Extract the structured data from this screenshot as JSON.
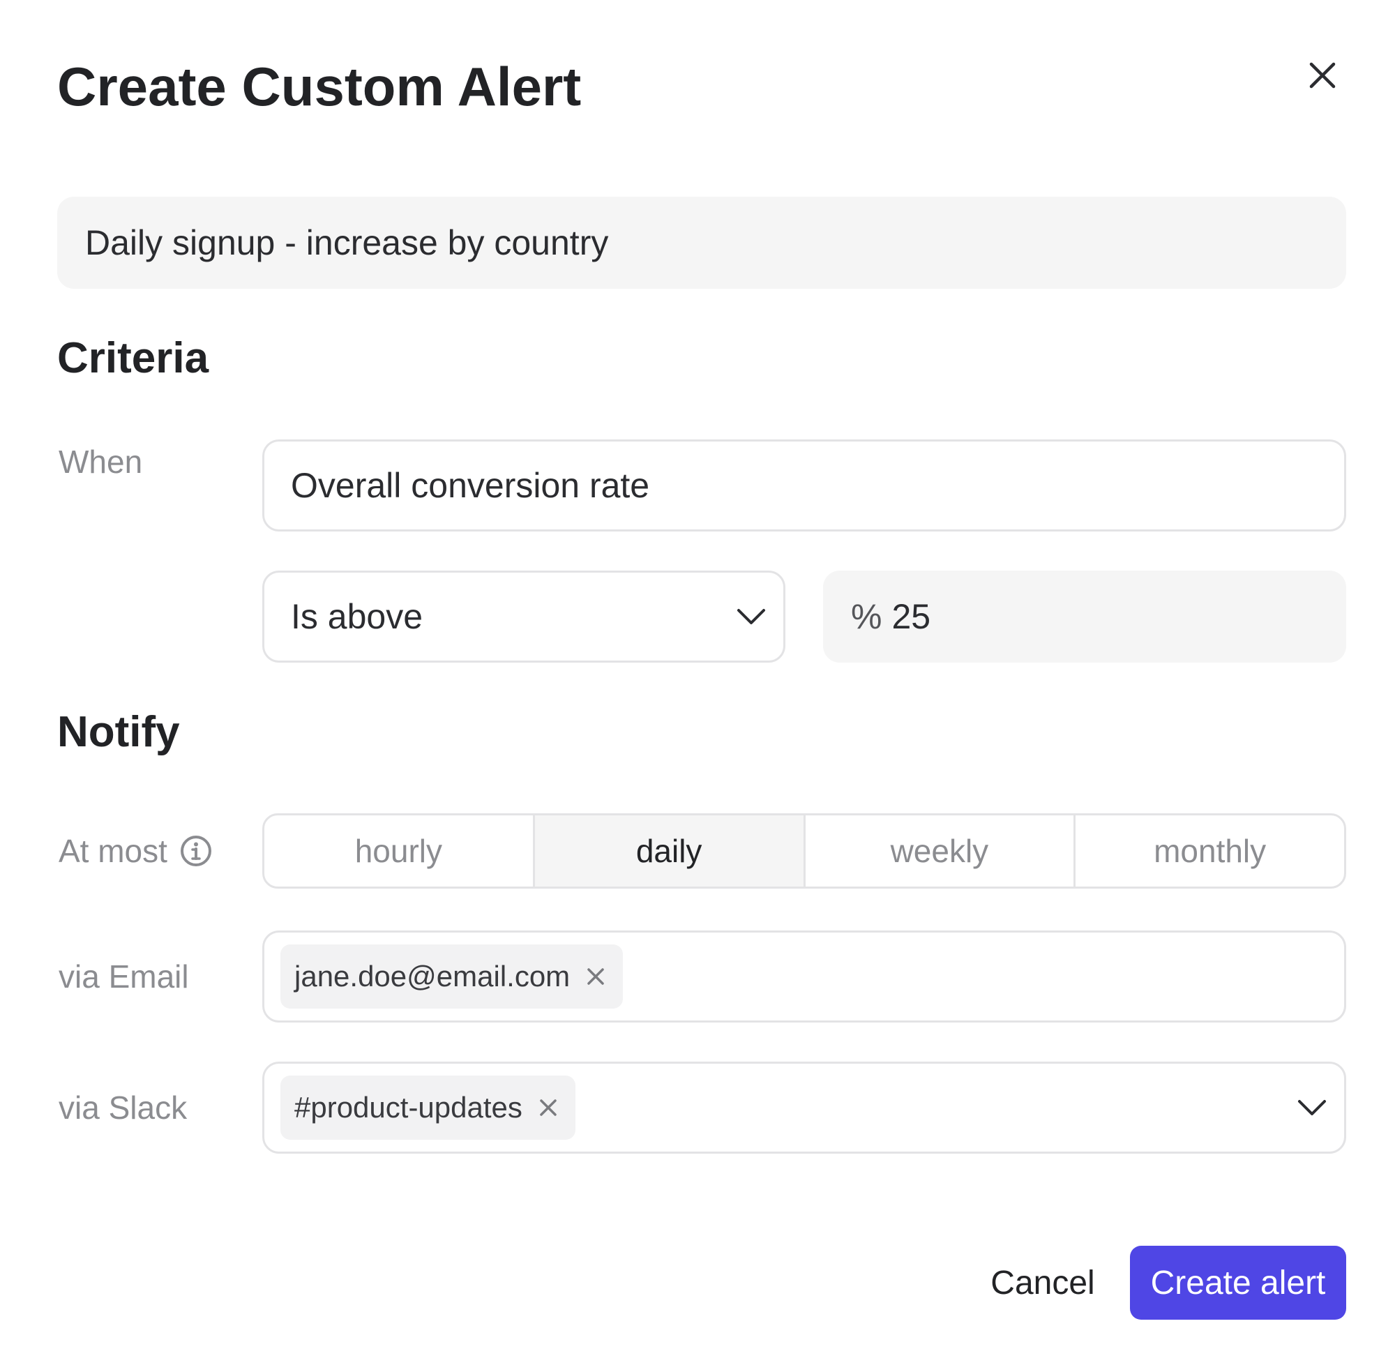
{
  "dialog": {
    "title": "Create Custom Alert"
  },
  "alert_name": {
    "value": "Daily signup - increase by country"
  },
  "criteria": {
    "heading": "Criteria",
    "when_label": "When",
    "metric_value": "Overall conversion rate",
    "condition_value": "Is above",
    "threshold_symbol": "%",
    "threshold_value": "25"
  },
  "notify": {
    "heading": "Notify",
    "frequency_label": "At most",
    "frequency_options": [
      "hourly",
      "daily",
      "weekly",
      "monthly"
    ],
    "frequency_selected": "daily",
    "email_label": "via Email",
    "email_chip": "jane.doe@email.com",
    "slack_label": "via Slack",
    "slack_chip": "#product-updates"
  },
  "actions": {
    "cancel_label": "Cancel",
    "create_label": "Create alert"
  },
  "colors": {
    "primary": "#4f46e5",
    "field_background": "#f5f5f5",
    "border": "#e3e3e5",
    "muted_text": "#8b8c90"
  },
  "icons": {
    "close": "close-icon",
    "dropdown": "chevron-down-icon",
    "info": "info-icon",
    "chip_remove": "close-icon"
  }
}
